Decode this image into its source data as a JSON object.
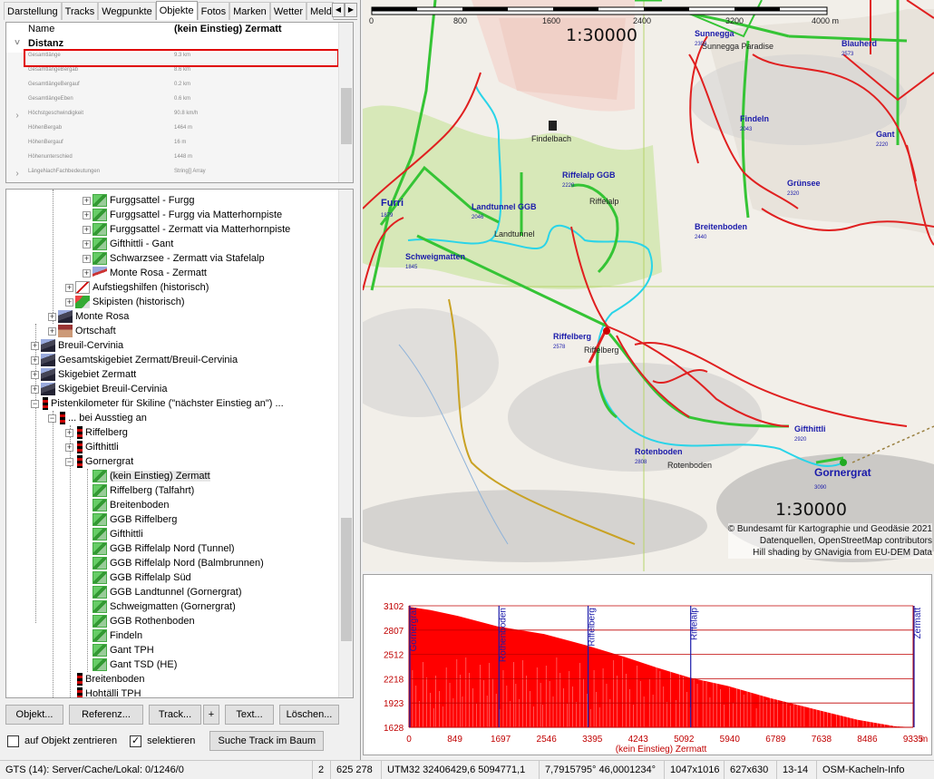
{
  "tabs": [
    "Darstellung",
    "Tracks",
    "Wegpunkte",
    "Objekte",
    "Fotos",
    "Marken",
    "Wetter",
    "Meldun"
  ],
  "active_tab": "Objekte",
  "props": {
    "header_name": "Name",
    "header_value": "(kein Einstieg) Zermatt",
    "category": "Distanz",
    "rows": [
      {
        "name": "Gesamtlänge",
        "value": "9.3 km"
      },
      {
        "name": "GesamtlängeBergab",
        "value": "8.6 km"
      },
      {
        "name": "GesamtlängeBergauf",
        "value": "0.2 km"
      },
      {
        "name": "GesamtlängeEben",
        "value": "0.6 km"
      },
      {
        "name": "Höchstgeschwindigkeit",
        "value": "90.8 km/h"
      },
      {
        "name": "HöhenBergab",
        "value": "1464 m"
      },
      {
        "name": "HöhenBergauf",
        "value": "16 m"
      },
      {
        "name": "Höhenunterschied",
        "value": "1448 m"
      },
      {
        "name": "LängeNachFachbedeutungen",
        "value": "String[] Array"
      }
    ]
  },
  "tree": [
    "Furggsattel - Furgg",
    "Furggsattel - Furgg via Matterhornpiste",
    "Furggsattel - Zermatt via Matterhornpiste",
    "Gifthittli - Gant",
    "Schwarzsee - Zermatt via Stafelalp",
    "Monte Rosa - Zermatt",
    "Aufstiegshilfen (historisch)",
    "Skipisten (historisch)",
    "Monte Rosa",
    "Ortschaft",
    "Breuil-Cervinia",
    "Gesamtskigebiet Zermatt/Breuil-Cervinia",
    "Skigebiet Zermatt",
    "Skigebiet Breuil-Cervinia",
    "Pistenkilometer für Skiline (\"nächster Einstieg an\") ...",
    "... bei Ausstieg an",
    "Riffelberg",
    "Gifthittli",
    "Gornergrat",
    "(kein Einstieg) Zermatt",
    "Riffelberg (Talfahrt)",
    "Breitenboden",
    "GGB Riffelberg",
    "Gifthittli",
    "GGB Riffelalp Nord (Tunnel)",
    "GGB Riffelalp Nord (Balmbrunnen)",
    "GGB Riffelalp Süd",
    "GGB Landtunnel (Gornergrat)",
    "Schweigmatten (Gornergrat)",
    "GGB Rothenboden",
    "Findeln",
    "Gant TPH",
    "Gant TSD (HE)",
    "Breitenboden",
    "Hohtälli TPH"
  ],
  "buttons": {
    "objekt": "Objekt...",
    "referenz": "Referenz...",
    "track": "Track...",
    "plus": "+",
    "text": "Text...",
    "loeschen": "Löschen..."
  },
  "checks": {
    "center": "auf Objekt zentrieren",
    "center_checked": false,
    "selected": "selektieren",
    "selected_checked": true,
    "search_btn": "Suche Track im Baum"
  },
  "map": {
    "scale_top": "1:30000",
    "scale_bottom": "1:30000",
    "ruler_labels": [
      "0",
      "800",
      "1600",
      "2400",
      "3200",
      "4000 m"
    ],
    "places": [
      {
        "name": "Sunnegga",
        "alt": "2302"
      },
      {
        "name": "Blauherd",
        "alt": "2573"
      },
      {
        "name": "Findeln",
        "alt": "2043"
      },
      {
        "name": "Gant",
        "alt": "2220"
      },
      {
        "name": "Grünsee",
        "alt": "2320"
      },
      {
        "name": "Breitenboden",
        "alt": "2440"
      },
      {
        "name": "Riffelalp GGB",
        "alt": "2220"
      },
      {
        "name": "Landtunnel GGB",
        "alt": "2046"
      },
      {
        "name": "Furri",
        "alt": "1879"
      },
      {
        "name": "Schweigmatten",
        "alt": "1845"
      },
      {
        "name": "Riffelberg",
        "alt": "2578"
      },
      {
        "name": "Gifthittli",
        "alt": "2920"
      },
      {
        "name": "Rotenboden",
        "alt": "2808"
      },
      {
        "name": "Gornergrat",
        "alt": "3090"
      }
    ],
    "plain_labels": [
      "Findelbach",
      "Riffelalp",
      "Landtunnel",
      "Riffelberg",
      "Rotenboden",
      "Sunnegga Paradise"
    ],
    "attribution": [
      "© Bundesamt für Kartographie und Geodäsie 2021",
      "Datenquellen, OpenStreetMap contributors",
      "Hill shading by GNavigia from EU-DEM Data"
    ]
  },
  "chart_data": {
    "type": "area",
    "xlabel": "(kein Einstieg) Zermatt",
    "x_unit": "m",
    "xlim": [
      0,
      9335
    ],
    "ylim": [
      1628,
      3102
    ],
    "x_ticks": [
      0,
      849,
      1697,
      2546,
      3395,
      4243,
      5092,
      5940,
      6789,
      7638,
      8486,
      9335
    ],
    "y_ticks": [
      1628,
      1923,
      2218,
      2512,
      2807,
      3102
    ],
    "markers": [
      {
        "name": "Gornergrat",
        "x": 0
      },
      {
        "name": "Rothenboden",
        "x": 1650
      },
      {
        "name": "Riffelberg",
        "x": 3300
      },
      {
        "name": "Riffelalp",
        "x": 5200
      },
      {
        "name": "Zermatt",
        "x": 9335
      }
    ],
    "profile": [
      {
        "x": 0,
        "y": 3090
      },
      {
        "x": 400,
        "y": 3050
      },
      {
        "x": 900,
        "y": 2980
      },
      {
        "x": 1650,
        "y": 2850
      },
      {
        "x": 2500,
        "y": 2760
      },
      {
        "x": 3300,
        "y": 2620
      },
      {
        "x": 4000,
        "y": 2480
      },
      {
        "x": 4600,
        "y": 2350
      },
      {
        "x": 5200,
        "y": 2230
      },
      {
        "x": 5900,
        "y": 2130
      },
      {
        "x": 6700,
        "y": 1980
      },
      {
        "x": 7500,
        "y": 1850
      },
      {
        "x": 8300,
        "y": 1720
      },
      {
        "x": 9000,
        "y": 1640
      },
      {
        "x": 9335,
        "y": 1628
      }
    ],
    "colors": {
      "fill": "#ff0000",
      "grid": "#c00000",
      "marker": "#1a1aaa"
    }
  },
  "status": [
    "GTS (14): Server/Cache/Lokal: 0/1246/0",
    "2",
    "625  278",
    "UTM32 32406429,6  5094771,1",
    "7,7915795°  46,0001234°",
    "1047x1016",
    "627x630",
    "13-14",
    "OSM-Kacheln-Info"
  ]
}
